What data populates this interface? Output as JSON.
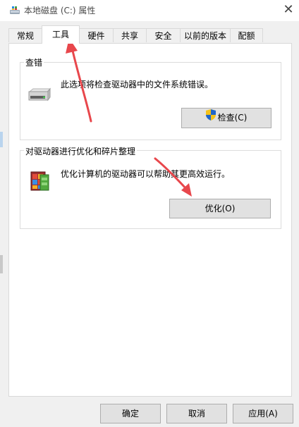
{
  "window": {
    "title": "本地磁盘 (C:) 属性",
    "close_glyph": "✕"
  },
  "tabs": [
    {
      "label": "常规",
      "active": false
    },
    {
      "label": "工具",
      "active": true
    },
    {
      "label": "硬件",
      "active": false
    },
    {
      "label": "共享",
      "active": false
    },
    {
      "label": "安全",
      "active": false
    },
    {
      "label": "以前的版本",
      "active": false
    },
    {
      "label": "配额",
      "active": false
    }
  ],
  "check_section": {
    "title": "查错",
    "description": "此选项将检查驱动器中的文件系统错误。",
    "button_label": "检查(C)",
    "icon": "drive-icon",
    "button_icon": "uac-shield-icon"
  },
  "optimize_section": {
    "title": "对驱动器进行优化和碎片整理",
    "description": "优化计算机的驱动器可以帮助其更高效运行。",
    "button_label": "优化(O)",
    "icon": "defrag-icon"
  },
  "footer": {
    "ok_label": "确定",
    "cancel_label": "取消",
    "apply_label": "应用(A)"
  },
  "annotation_color": "#e8474c"
}
